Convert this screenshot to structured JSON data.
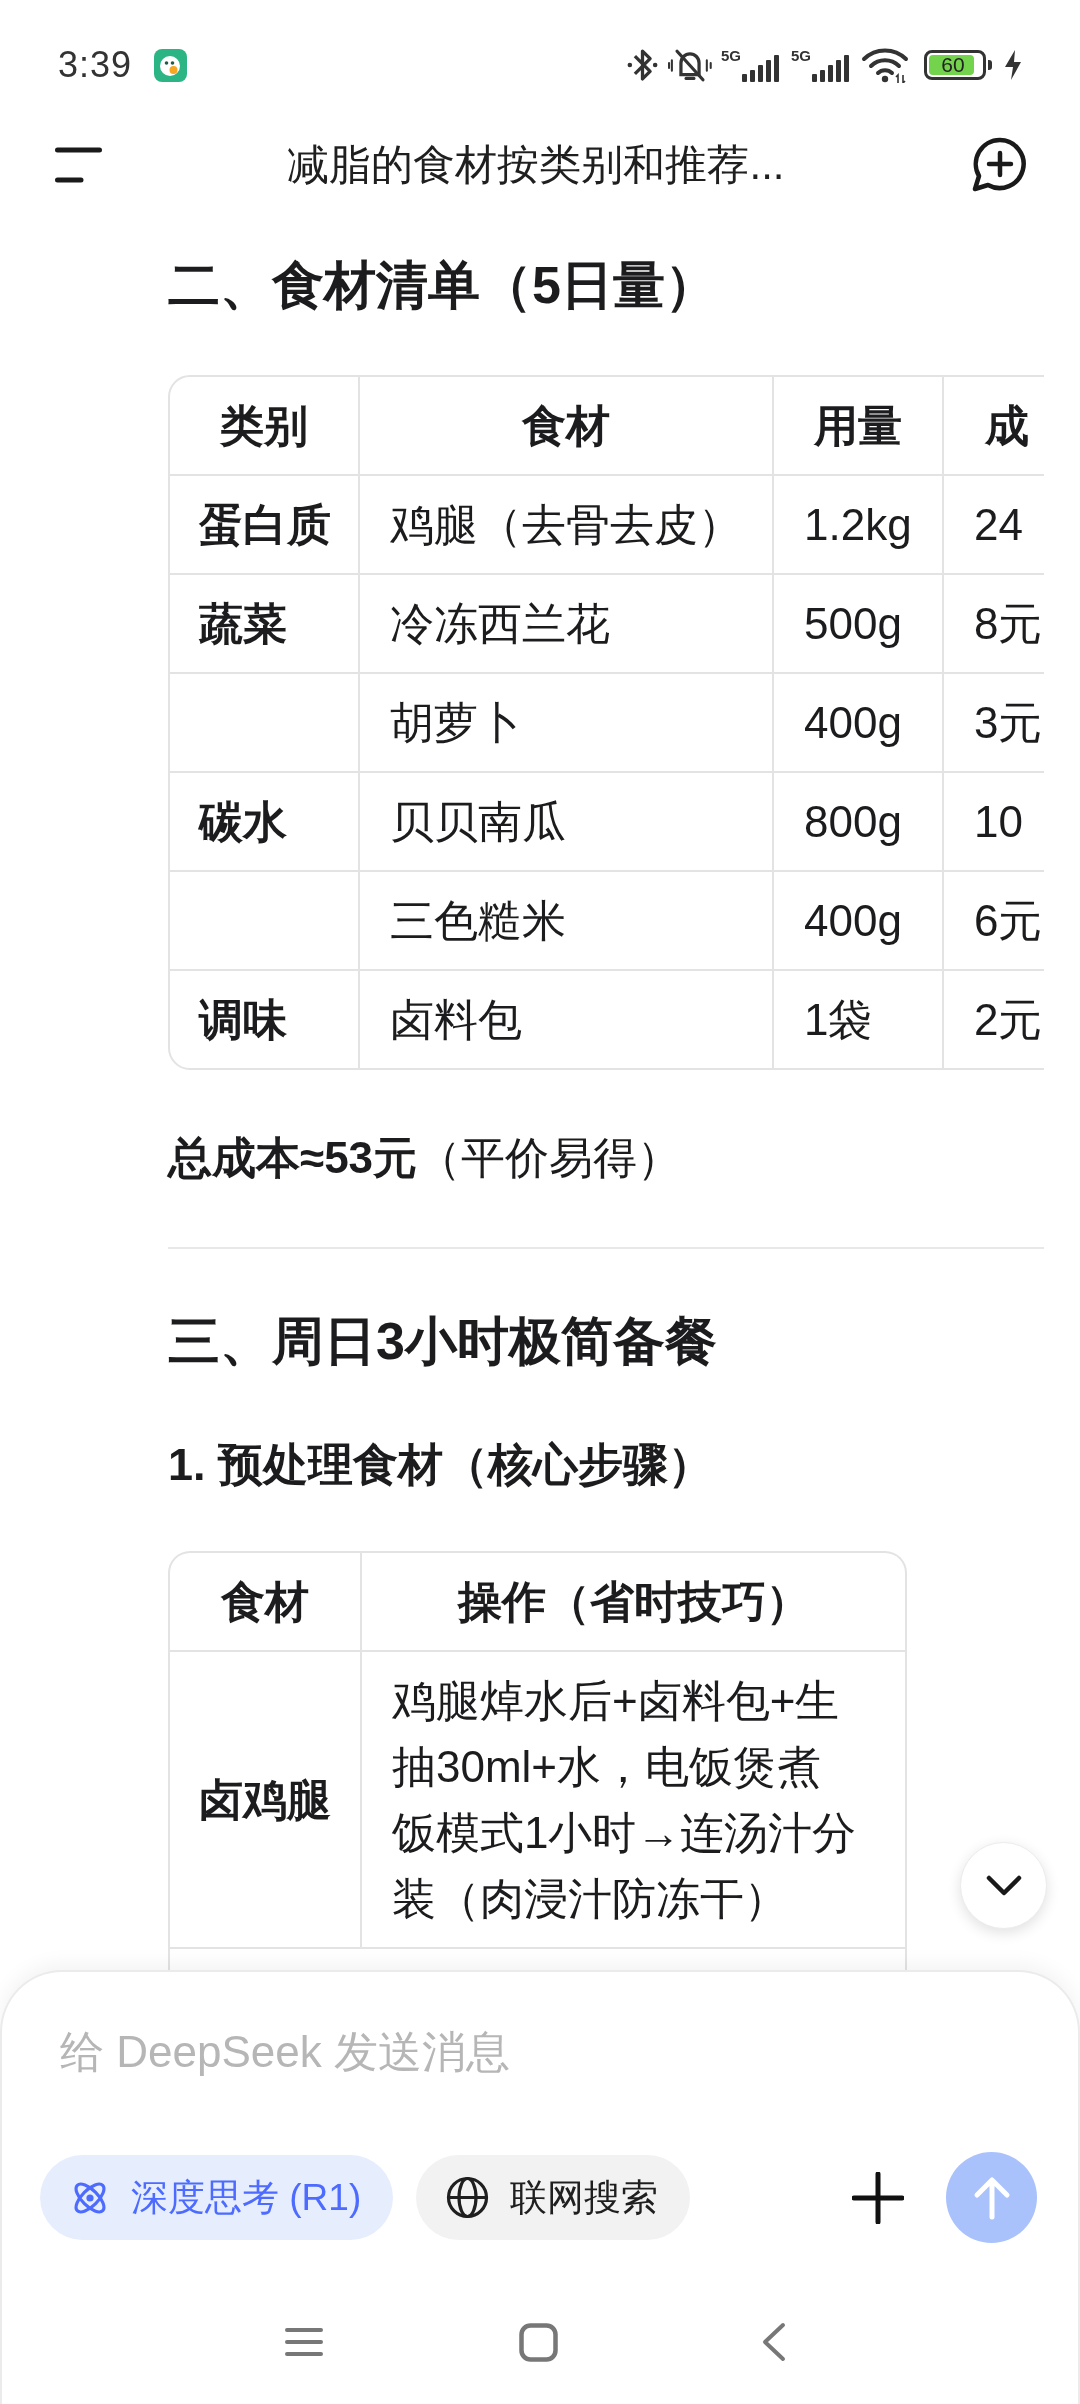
{
  "status_bar": {
    "time": "3:39",
    "network": [
      "5G",
      "5G"
    ],
    "battery": "60"
  },
  "header": {
    "title": "减脂的食材按类别和推荐..."
  },
  "content": [
    {
      "kind": "heading",
      "text": "二、食材清单（5日量）"
    },
    {
      "kind": "table",
      "columns": [
        "类别",
        "食材",
        "用量",
        "成"
      ],
      "rows": [
        [
          "蛋白质",
          "鸡腿（去骨去皮）",
          "1.2kg",
          "24"
        ],
        [
          "蔬菜",
          "冷冻西兰花",
          "500g",
          "8元"
        ],
        [
          "",
          "胡萝卜",
          "400g",
          "3元"
        ],
        [
          "碳水",
          "贝贝南瓜",
          "800g",
          "10"
        ],
        [
          "",
          "三色糙米",
          "400g",
          "6元"
        ],
        [
          "调味",
          "卤料包",
          "1袋",
          "2元"
        ]
      ]
    },
    {
      "kind": "paragraph",
      "text": "**总成本≈53元**（平价易得）"
    },
    {
      "kind": "divider"
    },
    {
      "kind": "heading",
      "text": "三、周日3小时极简备餐"
    },
    {
      "kind": "subheading",
      "text": "1. 预处理食材（核心步骤）"
    },
    {
      "kind": "table",
      "columns": [
        "食材",
        "操作（省时技巧）"
      ],
      "rows": [
        [
          "卤鸡腿",
          "鸡腿焯水后+卤料包+生抽30ml+水，电饭煲煮饭模式1小时→连汤汁分装（肉浸汁防冻干）"
        ]
      ]
    }
  ],
  "composer": {
    "placeholder": "给 DeepSeek 发送消息",
    "chips": [
      {
        "kind": "reasoning",
        "label": "深度思考 (R1)",
        "selected": true
      },
      {
        "kind": "web",
        "label": "联网搜索",
        "selected": false
      }
    ]
  }
}
